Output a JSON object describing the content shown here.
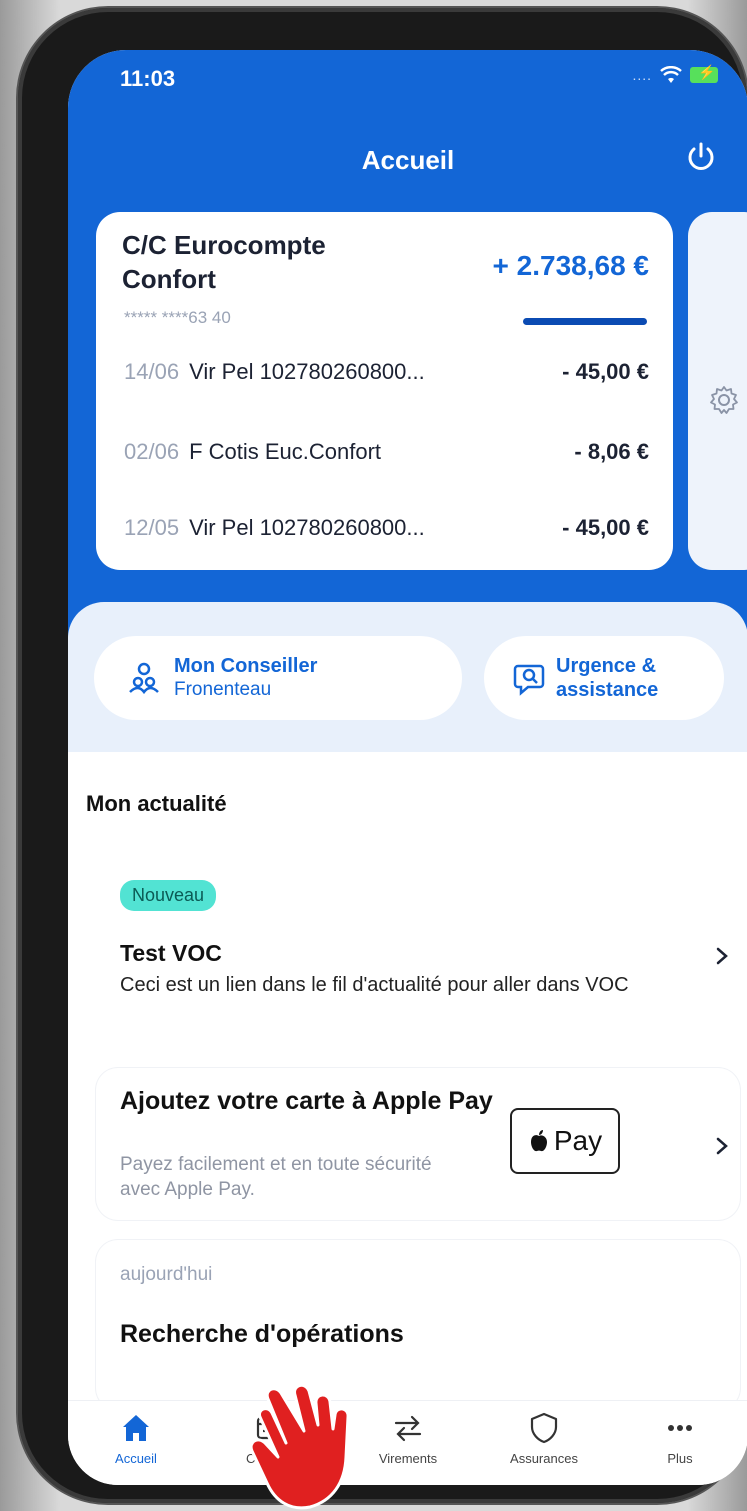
{
  "status_bar": {
    "time": "11:03"
  },
  "header": {
    "title": "Accueil"
  },
  "account": {
    "name": "C/C Eurocompte Confort",
    "balance": "+ 2.738,68 €",
    "number": "***** ****63 40",
    "transactions": [
      {
        "date": "14/06",
        "label": "Vir Pel 102780260800...",
        "amount": "- 45,00 €"
      },
      {
        "date": "02/06",
        "label": "F Cotis Euc.Confort",
        "amount": "- 8,06 €"
      },
      {
        "date": "12/05",
        "label": "Vir Pel 102780260800...",
        "amount": "- 45,00 €"
      }
    ]
  },
  "quick_actions": {
    "conseiller": {
      "title": "Mon Conseiller",
      "subtitle": "Fronenteau"
    },
    "urgence": {
      "title": "Urgence &",
      "subtitle": "assistance"
    }
  },
  "news": {
    "section_title": "Mon actualité",
    "items": [
      {
        "badge": "Nouveau",
        "title": "Test VOC",
        "description": "Ceci est un lien dans le fil d'actualité pour aller dans VOC"
      },
      {
        "title": "Ajoutez votre carte à Apple Pay",
        "description": "Payez facilement et en toute sécurité avec Apple Pay.",
        "button_label": "Pay"
      },
      {
        "date": "aujourd'hui",
        "title": "Recherche d'opérations"
      }
    ]
  },
  "tabs": [
    {
      "label": "Accueil",
      "icon": "home-icon",
      "active": true
    },
    {
      "label": "Comptes",
      "icon": "card-icon",
      "active": false
    },
    {
      "label": "Virements",
      "icon": "transfer-icon",
      "active": false
    },
    {
      "label": "Assurances",
      "icon": "shield-icon",
      "active": false
    },
    {
      "label": "Plus",
      "icon": "more-icon",
      "active": false
    }
  ],
  "colors": {
    "primary": "#1366d6",
    "badge": "#52e3d3",
    "pointer": "#e02020"
  }
}
